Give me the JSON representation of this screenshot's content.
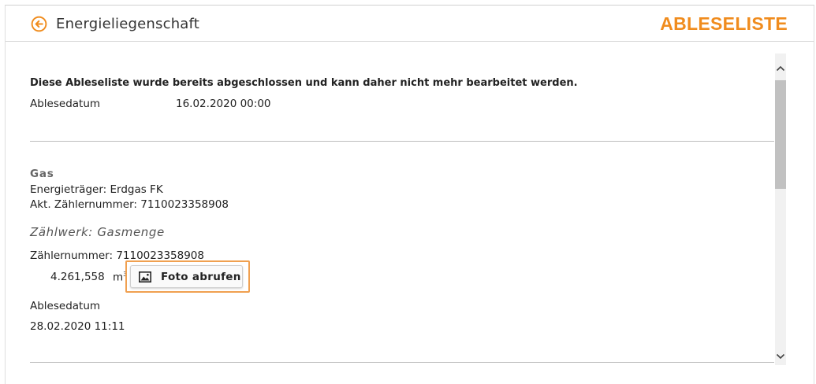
{
  "header": {
    "back_label": "Energieliegenschaft",
    "title": "ABLESELISTE"
  },
  "notice": "Diese Ableseliste wurde bereits abgeschlossen und kann daher nicht mehr bearbeitet werden.",
  "reading_date": {
    "label": "Ablesedatum",
    "value": "16.02.2020 00:00"
  },
  "meter": {
    "medium": "Gas",
    "energy_carrier": "Energieträger: Erdgas FK",
    "current_meter_number": "Akt. Zählernummer: 7110023358908",
    "counter_title": "Zählwerk: Gasmenge",
    "meter_number": "Zählernummer: 7110023358908",
    "value": "4.261,558",
    "unit": "m",
    "unit_sup": "3",
    "photo_button": "Foto abrufen",
    "date_label": "Ablesedatum",
    "date_value": "28.02.2020 11:11"
  },
  "colors": {
    "accent": "#f08c1e",
    "focus_outline": "#f0a050"
  },
  "icons": {
    "back": "arrow-left-circle-icon",
    "photo": "image-icon",
    "scroll_up": "chevron-up-icon",
    "scroll_down": "chevron-down-icon"
  }
}
